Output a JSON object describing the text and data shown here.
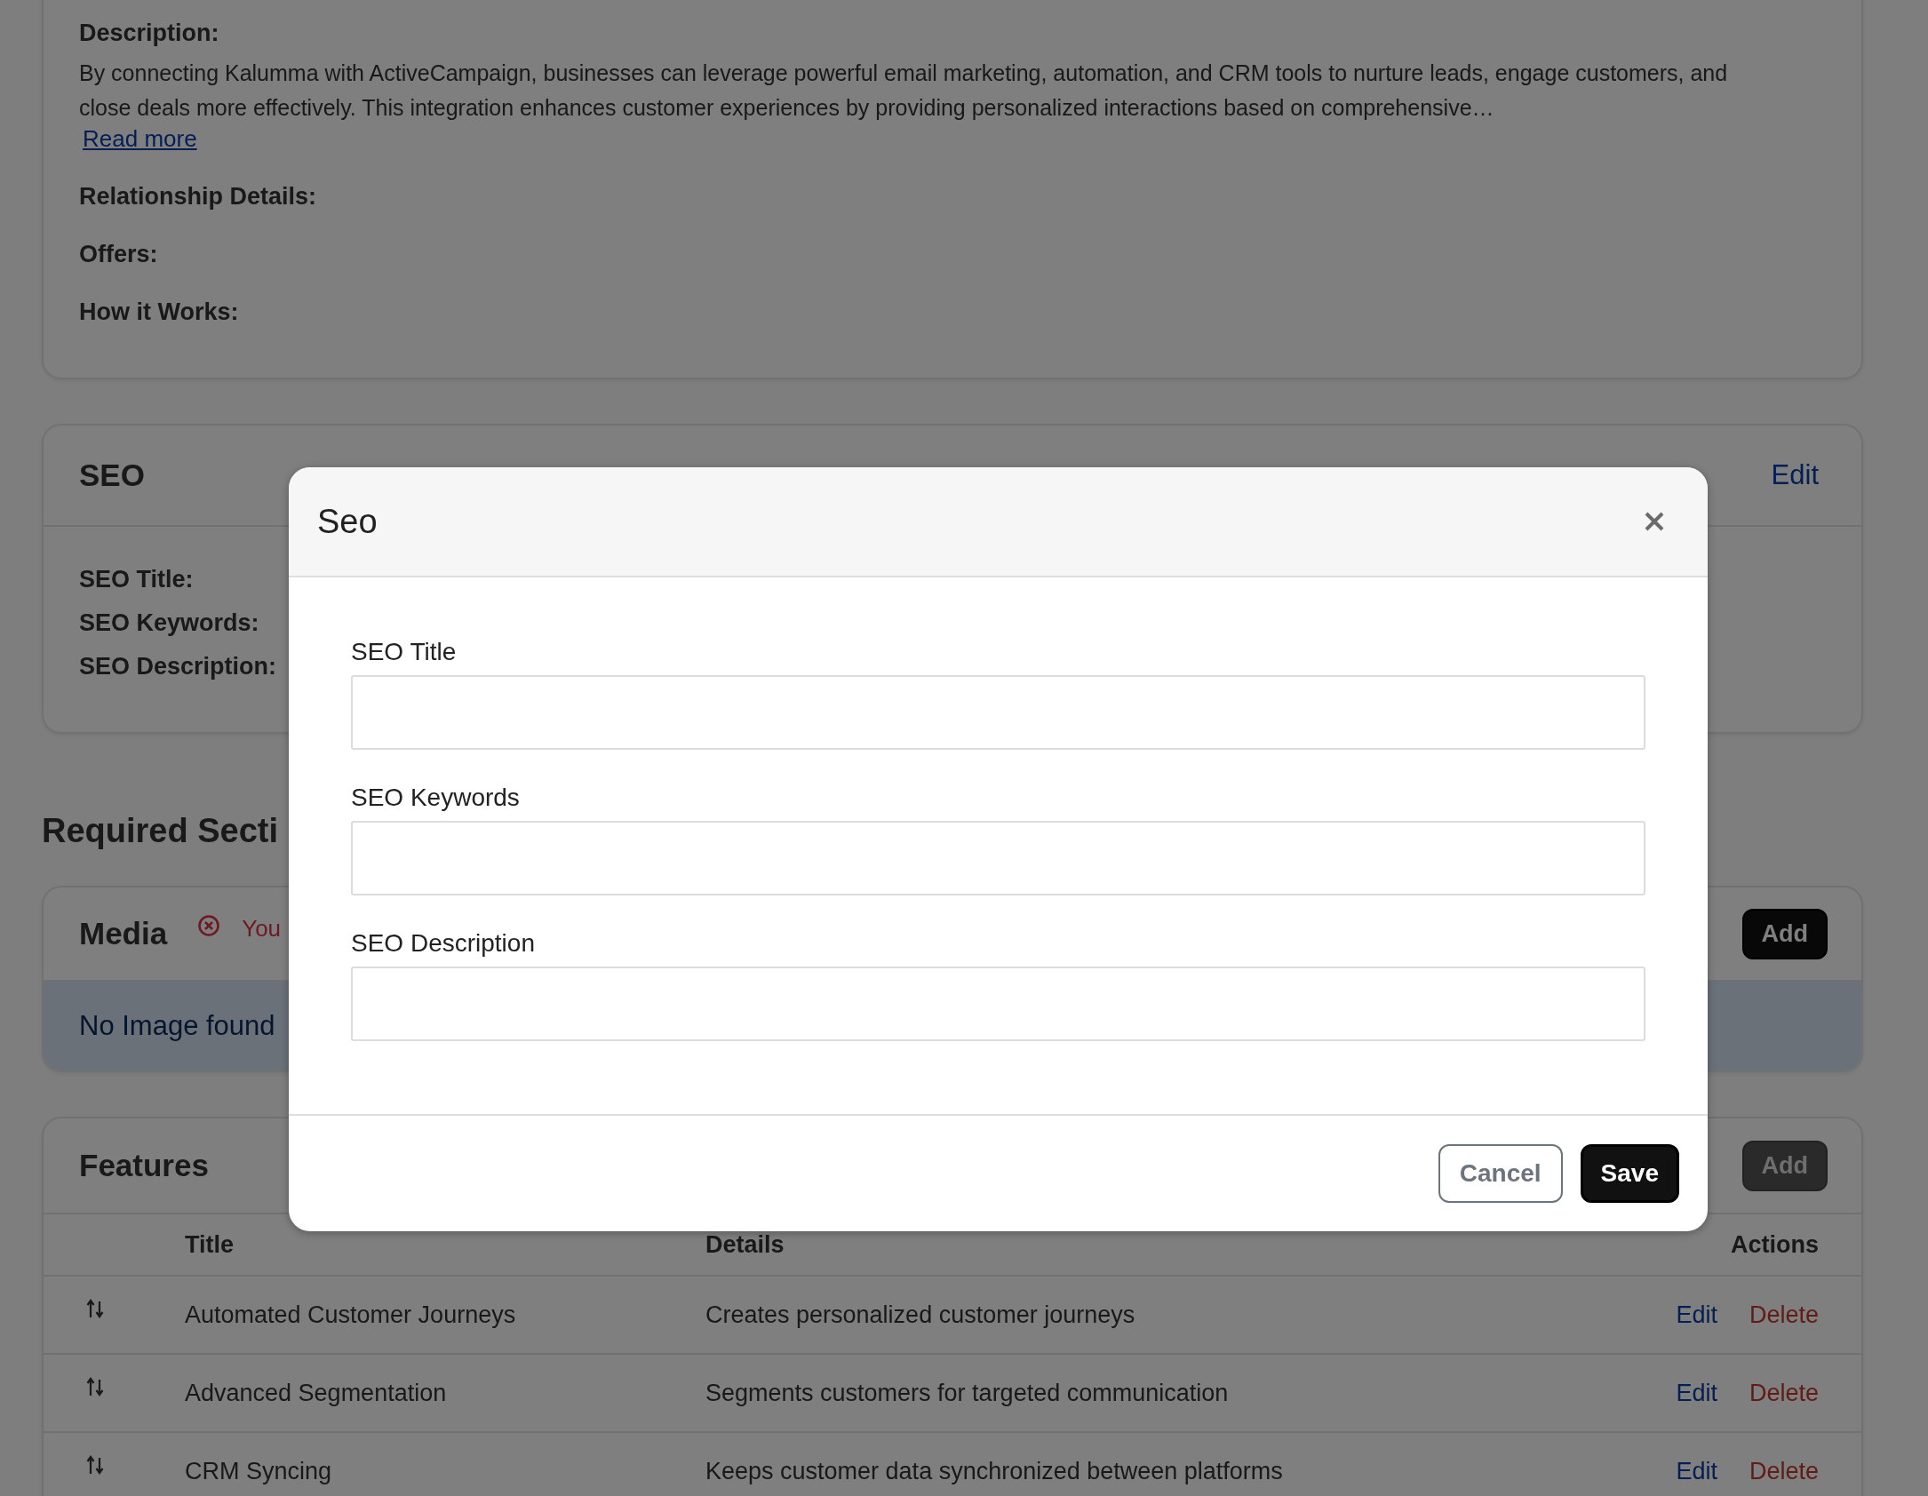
{
  "background": {
    "details_card": {
      "description_label": "Description:",
      "description": "By connecting Kalumma with ActiveCampaign, businesses can leverage powerful email marketing, automation, and CRM tools to nurture leads, engage customers, and close deals more effectively. This integration enhances customer experiences by providing personalized interactions based on comprehensive…",
      "read_more": "Read more",
      "fields": [
        "Relationship Details:",
        "Offers:",
        "How it Works:"
      ]
    },
    "seo_card": {
      "title": "SEO",
      "edit": "Edit",
      "fields": [
        "SEO Title:",
        "SEO Keywords:",
        "SEO Description:"
      ]
    },
    "section_heading": "Required Secti",
    "media_card": {
      "title": "Media",
      "error": "You",
      "add_button": {
        "label": "Add",
        "disabled": false
      },
      "empty_message": "No Image found"
    },
    "features_card": {
      "title": "Features",
      "add_button": {
        "label": "Add",
        "disabled": true
      },
      "table": {
        "columns": [
          "Title",
          "Details",
          "Actions"
        ],
        "rows": [
          {
            "title": "Automated Customer Journeys",
            "details": "Creates personalized customer journeys",
            "actions": [
              {
                "label": "Edit",
                "kind": "edit"
              },
              {
                "label": "Delete",
                "kind": "delete"
              }
            ]
          },
          {
            "title": "Advanced Segmentation",
            "details": "Segments customers for targeted communication",
            "actions": [
              {
                "label": "Edit",
                "kind": "edit"
              },
              {
                "label": "Delete",
                "kind": "delete"
              }
            ]
          },
          {
            "title": "CRM Syncing",
            "details": "Keeps customer data synchronized between platforms",
            "actions": [
              {
                "label": "Edit",
                "kind": "edit"
              },
              {
                "label": "Delete",
                "kind": "delete"
              }
            ]
          }
        ]
      }
    }
  },
  "modal": {
    "title": "Seo",
    "fields": [
      {
        "label": "SEO Title"
      },
      {
        "label": "SEO Keywords"
      },
      {
        "label": "SEO Description"
      }
    ],
    "buttons": [
      {
        "label": "Cancel",
        "kind": "secondary"
      },
      {
        "label": "Save",
        "kind": "primary"
      }
    ]
  }
}
